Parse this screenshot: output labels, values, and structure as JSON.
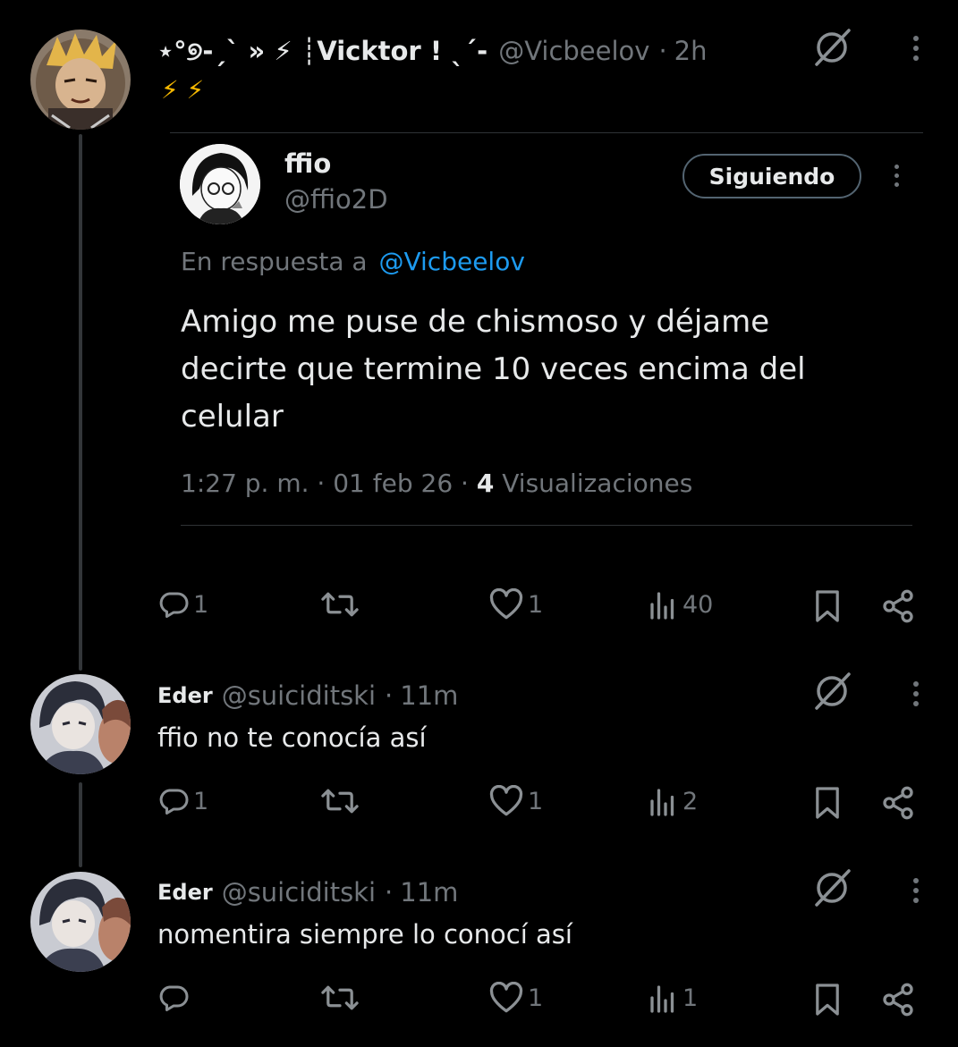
{
  "main_tweet": {
    "display_name": "⋆°୭-ˏˋ » ⚡ ┊Vicktor ! ˎˊ-",
    "handle": "@Vicbeelov",
    "separator": "·",
    "time": "2h",
    "text_line": "⚡ ⚡",
    "actions": {
      "replies": "1",
      "retweets": "",
      "likes": "1",
      "views": "40"
    }
  },
  "quoted": {
    "display_name": "ffio",
    "handle": "@ffio2D",
    "follow_label": "Siguiendo",
    "reply_prefix": "En respuesta a",
    "reply_to": "@Vicbeelov",
    "text_lines": [
      "Amigo me puse de chismoso y déjame",
      "decirte que termine 10 veces encima del",
      "celular"
    ],
    "meta_time": "1:27 p. m. · 01 feb 26 · ",
    "meta_views_count": "4",
    "meta_views_label": " Visualizaciones"
  },
  "replies": [
    {
      "display_name": "Eder",
      "handle": "@suiciditski",
      "separator": "·",
      "time": "11m",
      "text": "ffio no te conocía así",
      "actions": {
        "replies": "1",
        "retweets": "",
        "likes": "1",
        "views": "2"
      }
    },
    {
      "display_name": "Eder",
      "handle": "@suiciditski",
      "separator": "·",
      "time": "11m",
      "text": "nomentira siempre lo conocí así",
      "actions": {
        "replies": "",
        "retweets": "",
        "likes": "1",
        "views": "1"
      }
    }
  ],
  "colors": {
    "background": "#000000",
    "text": "#e7e9ea",
    "muted": "#71767b",
    "link": "#1d9bf0",
    "divider": "#2f3336",
    "lightning": "#f5b800"
  },
  "icons": {
    "grok": "slashed-circle-icon",
    "more": "more-vertical-icon",
    "reply": "reply-bubble-icon",
    "retweet": "retweet-icon",
    "like": "heart-icon",
    "views": "bar-chart-icon",
    "bookmark": "bookmark-icon",
    "share": "share-icon"
  }
}
